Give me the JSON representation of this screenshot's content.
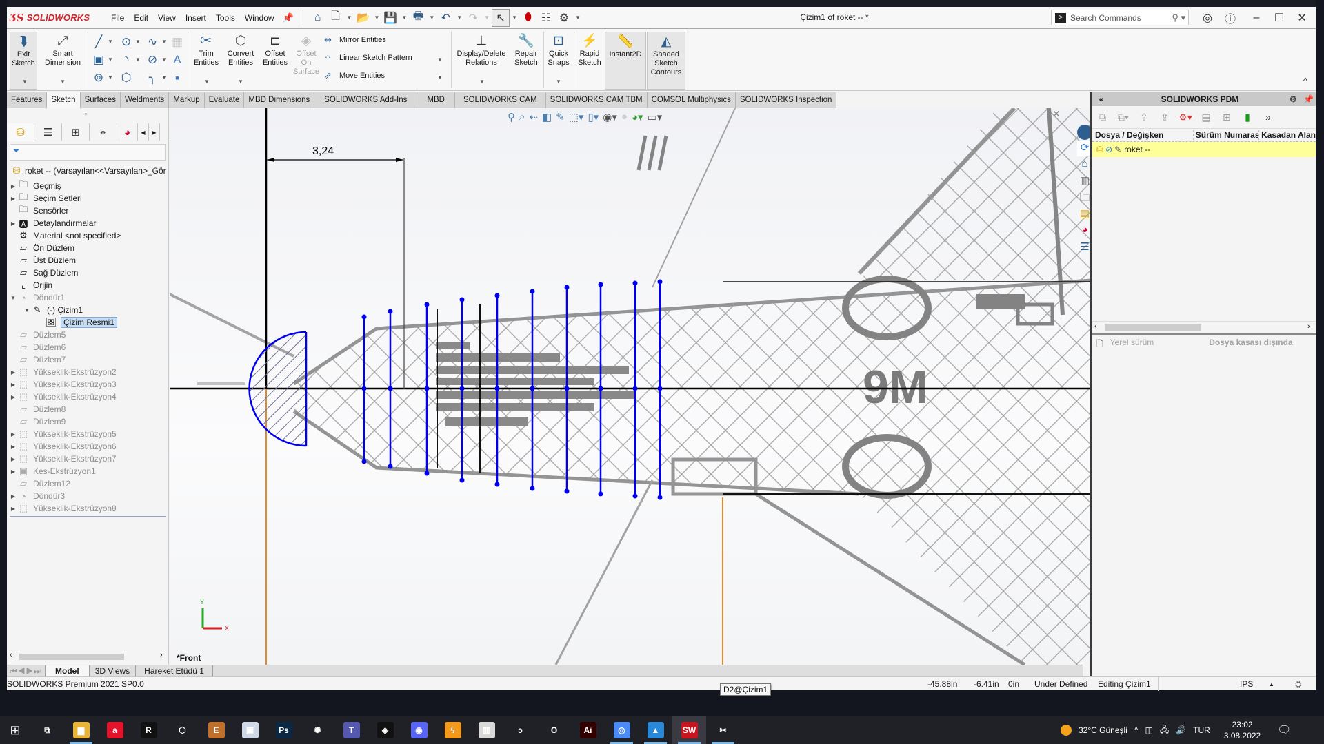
{
  "app": {
    "brand": "SOLIDWORKS",
    "document_title": "Çizim1 of roket -- *",
    "menu": [
      "File",
      "Edit",
      "View",
      "Insert",
      "Tools",
      "Window"
    ],
    "search_placeholder": "Search Commands"
  },
  "ribbon": {
    "exit_sketch": "Exit Sketch",
    "smart_dimension": "Smart Dimension",
    "trim_entities": "Trim Entities",
    "convert_entities": "Convert Entities",
    "offset_entities": "Offset Entities",
    "offset_on_surface": "Offset On Surface",
    "mirror_entities": "Mirror Entities",
    "linear_sketch_pattern": "Linear Sketch Pattern",
    "move_entities": "Move Entities",
    "display_delete_relations": "Display/Delete Relations",
    "repair_sketch": "Repair Sketch",
    "quick_snaps": "Quick Snaps",
    "rapid_sketch": "Rapid Sketch",
    "instant2d": "Instant2D",
    "shaded_sketch_contours": "Shaded Sketch Contours"
  },
  "tabs": [
    {
      "label": "Features",
      "active": false
    },
    {
      "label": "Sketch",
      "active": true
    },
    {
      "label": "Surfaces",
      "active": false
    },
    {
      "label": "Weldments",
      "active": false
    },
    {
      "label": "Markup",
      "active": false
    },
    {
      "label": "Evaluate",
      "active": false
    },
    {
      "label": "MBD Dimensions",
      "active": false
    },
    {
      "label": "SOLIDWORKS Add-Ins",
      "active": false
    },
    {
      "label": "MBD",
      "active": false
    },
    {
      "label": "SOLIDWORKS CAM",
      "active": false
    },
    {
      "label": "SOLIDWORKS CAM TBM",
      "active": false
    },
    {
      "label": "COMSOL Multiphysics",
      "active": false
    },
    {
      "label": "SOLIDWORKS Inspection",
      "active": false
    }
  ],
  "feature_tree": {
    "root": "roket --  (Varsayılan<<Varsayılan>_Gör",
    "items": [
      {
        "label": "Geçmiş",
        "icon": "history-folder-icon",
        "expandable": true,
        "indent": 0,
        "dim": false
      },
      {
        "label": "Seçim Setleri",
        "icon": "selection-sets-icon",
        "expandable": true,
        "indent": 0,
        "dim": false
      },
      {
        "label": "Sensörler",
        "icon": "sensors-icon",
        "expandable": false,
        "indent": 0,
        "dim": false
      },
      {
        "label": "Detaylandırmalar",
        "icon": "annotations-icon",
        "expandable": true,
        "indent": 0,
        "dim": false
      },
      {
        "label": "Material <not specified>",
        "icon": "material-icon",
        "expandable": false,
        "indent": 0,
        "dim": false
      },
      {
        "label": "Ön Düzlem",
        "icon": "plane-icon",
        "expandable": false,
        "indent": 0,
        "dim": false
      },
      {
        "label": "Üst Düzlem",
        "icon": "plane-icon",
        "expandable": false,
        "indent": 0,
        "dim": false
      },
      {
        "label": "Sağ Düzlem",
        "icon": "plane-icon",
        "expandable": false,
        "indent": 0,
        "dim": false
      },
      {
        "label": "Orijin",
        "icon": "origin-icon",
        "expandable": false,
        "indent": 0,
        "dim": false
      },
      {
        "label": "Döndür1",
        "icon": "revolve-icon",
        "expandable": true,
        "expanded": true,
        "indent": 0,
        "dim": true
      },
      {
        "label": "(-) Çizim1",
        "icon": "sketch-icon",
        "expandable": true,
        "expanded": true,
        "indent": 1,
        "dim": false
      },
      {
        "label": "Çizim Resmi1",
        "icon": "sketch-picture-icon",
        "expandable": false,
        "indent": 2,
        "dim": false,
        "selected": true
      },
      {
        "label": "Düzlem5",
        "icon": "plane-icon",
        "expandable": false,
        "indent": 0,
        "dim": true
      },
      {
        "label": "Düzlem6",
        "icon": "plane-icon",
        "expandable": false,
        "indent": 0,
        "dim": true
      },
      {
        "label": "Düzlem7",
        "icon": "plane-icon",
        "expandable": false,
        "indent": 0,
        "dim": true
      },
      {
        "label": "Yükseklik-Ekstrüzyon2",
        "icon": "extrude-icon",
        "expandable": true,
        "indent": 0,
        "dim": true
      },
      {
        "label": "Yükseklik-Ekstrüzyon3",
        "icon": "extrude-icon",
        "expandable": true,
        "indent": 0,
        "dim": true
      },
      {
        "label": "Yükseklik-Ekstrüzyon4",
        "icon": "extrude-icon",
        "expandable": true,
        "indent": 0,
        "dim": true
      },
      {
        "label": "Düzlem8",
        "icon": "plane-icon",
        "expandable": false,
        "indent": 0,
        "dim": true
      },
      {
        "label": "Düzlem9",
        "icon": "plane-icon",
        "expandable": false,
        "indent": 0,
        "dim": true
      },
      {
        "label": "Yükseklik-Ekstrüzyon5",
        "icon": "extrude-icon",
        "expandable": true,
        "indent": 0,
        "dim": true
      },
      {
        "label": "Yükseklik-Ekstrüzyon6",
        "icon": "extrude-icon",
        "expandable": true,
        "indent": 0,
        "dim": true
      },
      {
        "label": "Yükseklik-Ekstrüzyon7",
        "icon": "extrude-icon",
        "expandable": true,
        "indent": 0,
        "dim": true
      },
      {
        "label": "Kes-Ekstrüzyon1",
        "icon": "cut-extrude-icon",
        "expandable": true,
        "indent": 0,
        "dim": true
      },
      {
        "label": "Düzlem12",
        "icon": "plane-icon",
        "expandable": false,
        "indent": 0,
        "dim": true
      },
      {
        "label": "Döndür3",
        "icon": "revolve-icon",
        "expandable": true,
        "indent": 0,
        "dim": true
      },
      {
        "label": "Yükseklik-Ekstrüzyon8",
        "icon": "extrude-icon",
        "expandable": true,
        "indent": 0,
        "dim": true
      }
    ]
  },
  "graphics": {
    "dimension_value": "3,24",
    "view_label": "*Front",
    "image_text": "9M",
    "triad_y": "Y",
    "triad_x": "X"
  },
  "pdm": {
    "title": "SOLIDWORKS PDM",
    "columns": [
      "Dosya / Değişken",
      "Sürüm Numarası",
      "Kasadan Alan"
    ],
    "rows": [
      {
        "name": "roket --"
      }
    ],
    "local_version_label": "Yerel sürüm",
    "vault_status": "Dosya kasası dışında"
  },
  "bottom_tabs": [
    {
      "label": "Model",
      "active": true
    },
    {
      "label": "3D Views",
      "active": false
    },
    {
      "label": "Hareket Etüdü 1",
      "active": false
    }
  ],
  "status": {
    "product": "SOLIDWORKS Premium 2021 SP0.0",
    "x": "-45.88in",
    "y": "-6.41in",
    "z": "0in",
    "sketch_state": "Under Defined",
    "editing": "Editing Çizim1",
    "units": "IPS",
    "tooltip": "D2@Çizim1"
  },
  "taskbar": {
    "weather": "32°C  Güneşli",
    "language": "TUR",
    "time": "23:02",
    "date": "3.08.2022",
    "apps": [
      {
        "name": "task-view",
        "glyph": "⧉",
        "color": "transparent"
      },
      {
        "name": "file-explorer",
        "glyph": "▆",
        "color": "#e8b53a",
        "running": true
      },
      {
        "name": "amd-software",
        "glyph": "a",
        "color": "#e3132b"
      },
      {
        "name": "ryzen-master",
        "glyph": "R",
        "color": "#111"
      },
      {
        "name": "virtualbox",
        "glyph": "⬡",
        "color": "transparent"
      },
      {
        "name": "e-app",
        "glyph": "E",
        "color": "#c0702a"
      },
      {
        "name": "windows-media",
        "glyph": "▣",
        "color": "#cfd8e6"
      },
      {
        "name": "photoshop",
        "glyph": "Ps",
        "color": "#0a2844"
      },
      {
        "name": "network-app",
        "glyph": "✺",
        "color": "transparent"
      },
      {
        "name": "teams",
        "glyph": "T",
        "color": "#5558af"
      },
      {
        "name": "binance",
        "glyph": "◈",
        "color": "#111"
      },
      {
        "name": "discord",
        "glyph": "◉",
        "color": "#5865f2"
      },
      {
        "name": "bolt-app",
        "glyph": "ϟ",
        "color": "#f39a1c"
      },
      {
        "name": "monitor-app",
        "glyph": "▥",
        "color": "#d8d8d8"
      },
      {
        "name": "c-app",
        "glyph": "ↄ",
        "color": "transparent"
      },
      {
        "name": "opera",
        "glyph": "O",
        "color": "transparent"
      },
      {
        "name": "illustrator",
        "glyph": "Ai",
        "color": "#330000"
      },
      {
        "name": "chrome",
        "glyph": "◎",
        "color": "#4c8bf5",
        "running": true
      },
      {
        "name": "photos",
        "glyph": "▲",
        "color": "#2a88d8",
        "running": true
      },
      {
        "name": "solidworks-2021",
        "glyph": "SW",
        "color": "#c8141e",
        "running": true,
        "active": true
      },
      {
        "name": "snipping-tool",
        "glyph": "✂",
        "color": "transparent",
        "running": true
      }
    ]
  }
}
